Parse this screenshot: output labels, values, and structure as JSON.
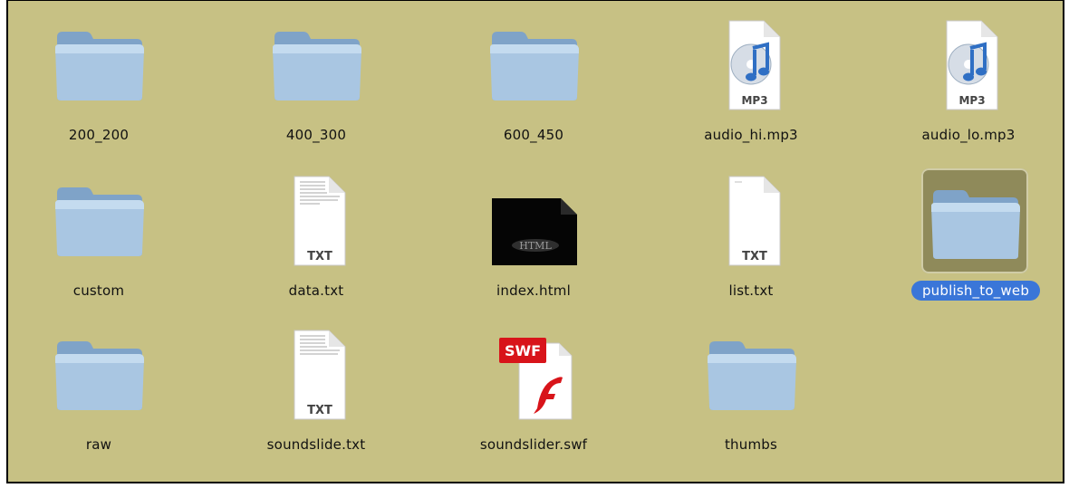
{
  "window": {
    "background": "#c7c184",
    "selection_color": "#3a76d8"
  },
  "items": [
    {
      "label": "200_200",
      "kind": "folder-icon",
      "selected": false
    },
    {
      "label": "400_300",
      "kind": "folder-icon",
      "selected": false
    },
    {
      "label": "600_450",
      "kind": "folder-icon",
      "selected": false
    },
    {
      "label": "audio_hi.mp3",
      "kind": "mp3-file-icon",
      "badge": "MP3",
      "selected": false
    },
    {
      "label": "audio_lo.mp3",
      "kind": "mp3-file-icon",
      "badge": "MP3",
      "selected": false
    },
    {
      "label": "custom",
      "kind": "folder-icon",
      "selected": false
    },
    {
      "label": "data.txt",
      "kind": "txt-file-icon",
      "badge": "TXT",
      "selected": false
    },
    {
      "label": "index.html",
      "kind": "html-file-icon",
      "badge": "HTML",
      "selected": false
    },
    {
      "label": "list.txt",
      "kind": "txt-file-icon",
      "badge": "TXT",
      "selected": false
    },
    {
      "label": "publish_to_web",
      "kind": "folder-icon",
      "selected": true
    },
    {
      "label": "raw",
      "kind": "folder-icon",
      "selected": false
    },
    {
      "label": "soundslide.txt",
      "kind": "txt-file-icon",
      "badge": "TXT",
      "selected": false
    },
    {
      "label": "soundslider.swf",
      "kind": "swf-file-icon",
      "badge": "SWF",
      "selected": false
    },
    {
      "label": "thumbs",
      "kind": "folder-icon",
      "selected": false
    }
  ]
}
